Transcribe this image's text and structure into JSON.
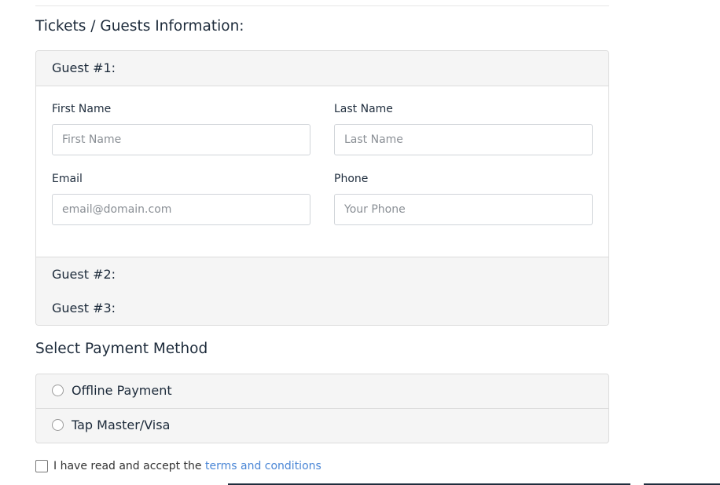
{
  "tickets": {
    "title": "Tickets / Guests Information:",
    "guests": [
      {
        "header": "Guest #1:"
      },
      {
        "header": "Guest #2:"
      },
      {
        "header": "Guest #3:"
      }
    ],
    "fields": {
      "first_name": {
        "label": "First Name",
        "placeholder": "First Name"
      },
      "last_name": {
        "label": "Last Name",
        "placeholder": "Last Name"
      },
      "email": {
        "label": "Email",
        "placeholder": "email@domain.com"
      },
      "phone": {
        "label": "Phone",
        "placeholder": "Your Phone"
      }
    }
  },
  "payment": {
    "title": "Select Payment Method",
    "options": [
      {
        "label": "Offline Payment"
      },
      {
        "label": "Tap Master/Visa"
      }
    ]
  },
  "terms": {
    "text": "I have read and accept the",
    "link_text": "terms and conditions",
    "link_color": "#4a86d6"
  }
}
